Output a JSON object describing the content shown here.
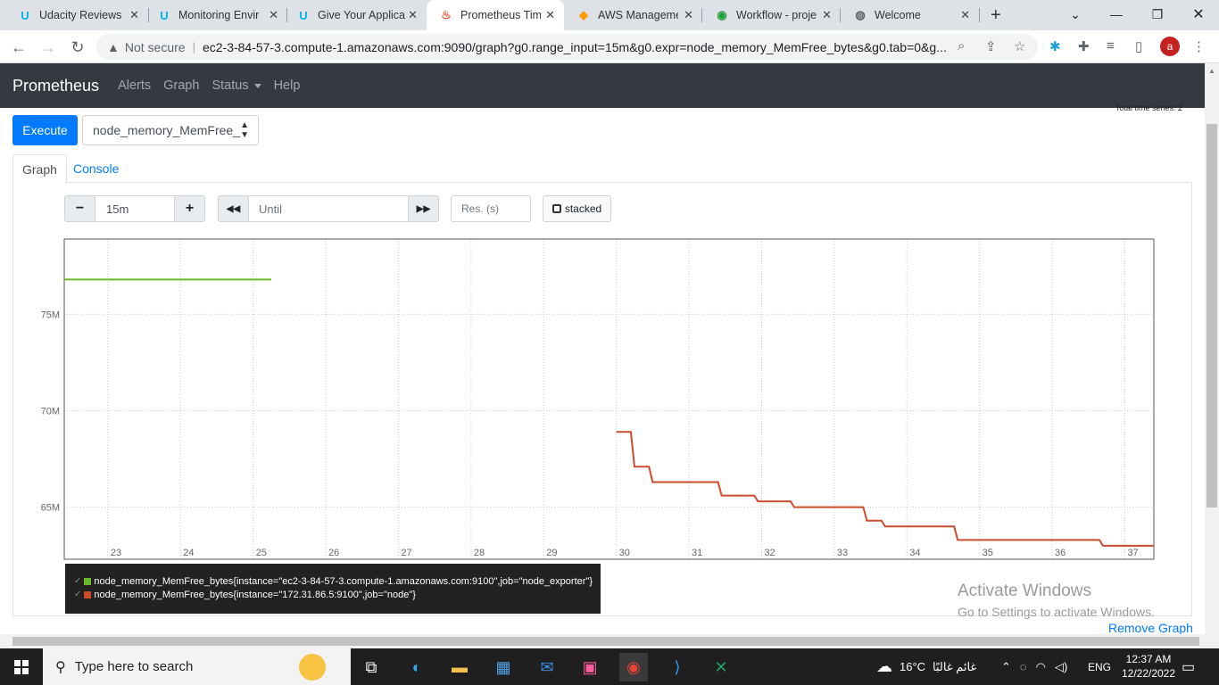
{
  "browser": {
    "tabs": [
      {
        "title": "Udacity Reviews",
        "icon": "udacity-icon"
      },
      {
        "title": "Monitoring Envir",
        "icon": "udacity-icon"
      },
      {
        "title": "Give Your Applica",
        "icon": "udacity-icon"
      },
      {
        "title": "Prometheus Time",
        "icon": "prometheus-icon"
      },
      {
        "title": "AWS Managemen",
        "icon": "aws-icon"
      },
      {
        "title": "Workflow - proje",
        "icon": "workflow-icon"
      },
      {
        "title": "Welcome",
        "icon": "globe-icon"
      }
    ],
    "active_tab": 3,
    "new_tab": "+",
    "security": "Not secure",
    "url": "ec2-3-84-57-3.compute-1.amazonaws.com:9090/graph?g0.range_input=15m&g0.expr=node_memory_MemFree_bytes&g0.tab=0&g...",
    "profile_initial": "a"
  },
  "prometheus": {
    "brand": "Prometheus",
    "nav": [
      "Alerts",
      "Graph",
      "Status",
      "Help"
    ],
    "total_series": "Total time series: 2",
    "execute_label": "Execute",
    "metric_select": "node_memory_MemFree_",
    "tabs": [
      "Graph",
      "Console"
    ],
    "controls": {
      "minus": "−",
      "range": "15m",
      "plus": "+",
      "back": "◀◀",
      "until_placeholder": "Until",
      "forward": "▶▶",
      "res_placeholder": "Res. (s)",
      "stacked": "stacked"
    },
    "legend": [
      {
        "label": "node_memory_MemFree_bytes{instance=\"ec2-3-84-57-3.compute-1.amazonaws.com:9100\",job=\"node_exporter\"}",
        "color": "#6ab827"
      },
      {
        "label": "node_memory_MemFree_bytes{instance=\"172.31.86.5:9100\",job=\"node\"}",
        "color": "#cb4b2c"
      }
    ],
    "remove_graph": "Remove Graph"
  },
  "chart_data": {
    "type": "line",
    "x_ticks": [
      "23",
      "24",
      "25",
      "26",
      "27",
      "28",
      "29",
      "30",
      "31",
      "32",
      "33",
      "34",
      "35",
      "36",
      "37"
    ],
    "y_ticks": [
      "75M",
      "70M",
      "65M"
    ],
    "xlim": [
      22.4,
      37.4
    ],
    "ylim": [
      62.3,
      78.9
    ],
    "series": [
      {
        "name": "node_memory_MemFree_bytes{instance=\"ec2-3-84-57-3.compute-1.amazonaws.com:9100\",job=\"node_exporter\"}",
        "color": "#6ab827",
        "points": [
          [
            22.4,
            76.8
          ],
          [
            25.25,
            76.8
          ]
        ]
      },
      {
        "name": "node_memory_MemFree_bytes{instance=\"172.31.86.5:9100\",job=\"node\"}",
        "color": "#cb4b2c",
        "points": [
          [
            30.0,
            68.9
          ],
          [
            30.2,
            68.9
          ],
          [
            30.25,
            67.1
          ],
          [
            30.45,
            67.1
          ],
          [
            30.5,
            66.3
          ],
          [
            31.4,
            66.3
          ],
          [
            31.45,
            65.6
          ],
          [
            31.9,
            65.6
          ],
          [
            31.95,
            65.3
          ],
          [
            32.4,
            65.3
          ],
          [
            32.45,
            65.0
          ],
          [
            33.4,
            65.0
          ],
          [
            33.45,
            64.3
          ],
          [
            33.65,
            64.3
          ],
          [
            33.7,
            64.0
          ],
          [
            34.65,
            64.0
          ],
          [
            34.7,
            63.3
          ],
          [
            36.65,
            63.3
          ],
          [
            36.7,
            63.0
          ],
          [
            37.4,
            63.0
          ]
        ]
      }
    ]
  },
  "watermark": {
    "line1": "Activate Windows",
    "line2": "Go to Settings to activate Windows."
  },
  "taskbar": {
    "search_placeholder": "Type here to search",
    "weather": "16°C",
    "weather_text": "غائم غالبًا",
    "language": "ENG",
    "time": "12:37 AM",
    "date": "12/22/2022"
  }
}
